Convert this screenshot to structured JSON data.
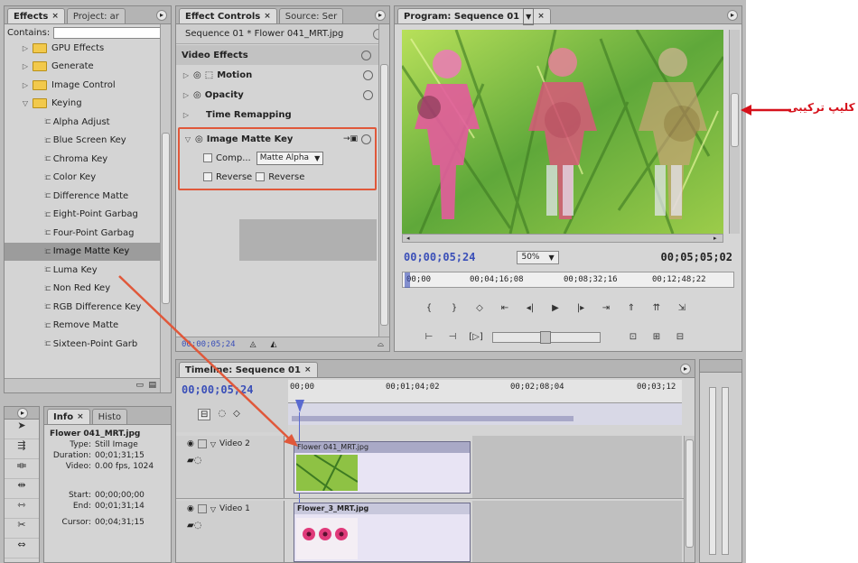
{
  "effects_panel": {
    "tabs": [
      {
        "label": "Effects"
      },
      {
        "label": "Project: ar"
      }
    ],
    "contains_label": "Contains:",
    "items": [
      {
        "label": "GPU Effects",
        "kind": "folder"
      },
      {
        "label": "Generate",
        "kind": "folder"
      },
      {
        "label": "Image Control",
        "kind": "folder"
      },
      {
        "label": "Keying",
        "kind": "folder-open"
      },
      {
        "label": "Alpha Adjust",
        "kind": "effect"
      },
      {
        "label": "Blue Screen Key",
        "kind": "effect"
      },
      {
        "label": "Chroma Key",
        "kind": "effect"
      },
      {
        "label": "Color Key",
        "kind": "effect"
      },
      {
        "label": "Difference Matte",
        "kind": "effect"
      },
      {
        "label": "Eight-Point Garbag",
        "kind": "effect"
      },
      {
        "label": "Four-Point Garbag",
        "kind": "effect"
      },
      {
        "label": "Image Matte Key",
        "kind": "effect",
        "selected": true
      },
      {
        "label": "Luma Key",
        "kind": "effect"
      },
      {
        "label": "Non Red Key",
        "kind": "effect"
      },
      {
        "label": "RGB Difference Key",
        "kind": "effect"
      },
      {
        "label": "Remove Matte",
        "kind": "effect"
      },
      {
        "label": "Sixteen-Point Garb",
        "kind": "effect"
      }
    ]
  },
  "effect_controls": {
    "tabs": [
      {
        "label": "Effect Controls"
      },
      {
        "label": "Source: Ser"
      }
    ],
    "clip_name": "Sequence 01 * Flower 041_MRT.jpg",
    "section": "Video Effects",
    "motion": "Motion",
    "opacity": "Opacity",
    "time_remap": "Time Remapping",
    "image_matte_key": "Image Matte Key",
    "comp_label": "Comp...",
    "comp_value": "Matte Alpha",
    "reverse_label": "Reverse",
    "reverse_check": "Reverse",
    "footer_tc": "00;00;05;24"
  },
  "program_monitor": {
    "tab": "Program: Sequence 01",
    "current_tc": "00;00;05;24",
    "zoom": "50%",
    "duration_tc": "00;05;05;02",
    "ruler": [
      "00;00",
      "00;04;16;08",
      "00;08;32;16",
      "00;12;48;22"
    ]
  },
  "info_panel": {
    "tabs": [
      {
        "label": "Info"
      },
      {
        "label": "Histo"
      }
    ],
    "name": "Flower 041_MRT.jpg",
    "type_label": "Type:",
    "type_value": "Still Image",
    "duration_label": "Duration:",
    "duration_value": "00;01;31;15",
    "video_label": "Video:",
    "video_value": "0.00 fps, 1024",
    "start_label": "Start:",
    "start_value": "00;00;00;00",
    "end_label": "End:",
    "end_value": "00;01;31;14",
    "cursor_label": "Cursor:",
    "cursor_value": "00;04;31;15"
  },
  "timeline": {
    "tab": "Timeline: Sequence 01",
    "current_tc": "00;00;05;24",
    "ruler": [
      "00;00",
      "00;01;04;02",
      "00;02;08;04",
      "00;03;12"
    ],
    "tracks": [
      {
        "label": "Video 2",
        "clip": "Flower 041_MRT.jpg"
      },
      {
        "label": "Video 1",
        "clip": "Flower_3_MRT.jpg"
      }
    ]
  },
  "annotation": {
    "text": "کلیپ ترکیبی",
    "color": "#d6111b"
  },
  "colors": {
    "highlight_box": "#e0583a",
    "arrow": "#e0583a",
    "timecode_blue": "#3a4fb8"
  }
}
